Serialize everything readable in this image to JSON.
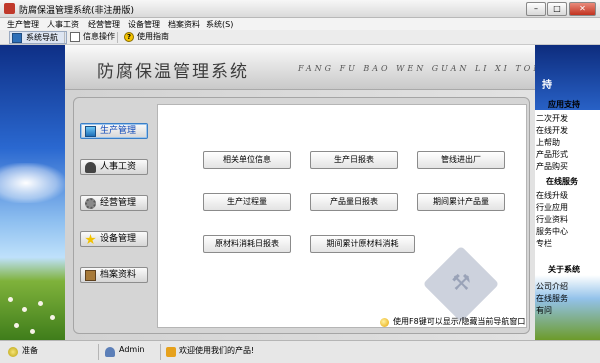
{
  "window": {
    "title": "防腐保温管理系统(非注册版)",
    "min": "–",
    "max": "□",
    "close": "✕"
  },
  "menu": [
    "生产管理",
    "人事工资",
    "经营管理",
    "设备管理",
    "档案资料",
    "系统(S)"
  ],
  "toolbar": [
    {
      "label": "系统导航",
      "icon": "navigation-icon"
    },
    {
      "label": "信息操作",
      "icon": "document-icon"
    },
    {
      "label": "使用指南",
      "icon": "help-icon",
      "glyph": "?"
    }
  ],
  "header": {
    "title": "防腐保温管理系统",
    "subtitle": "FANG FU BAO WEN GUAN LI XI TONG"
  },
  "nav": [
    {
      "label": "生产管理",
      "icon": "monitor-icon",
      "active": true
    },
    {
      "label": "人事工资",
      "icon": "person-icon"
    },
    {
      "label": "经营管理",
      "icon": "gear-icon"
    },
    {
      "label": "设备管理",
      "icon": "star-icon"
    },
    {
      "label": "档案资料",
      "icon": "archive-icon"
    }
  ],
  "functions": [
    "相关单位信息",
    "生产日报表",
    "管线进出厂",
    "生产过程量",
    "产品量日报表",
    "期间累计产品量",
    "原材料消耗日报表",
    "期间累计原材料消耗"
  ],
  "hint": "使用F8键可以显示/隐藏当前导航窗口",
  "right_sidebar": {
    "heading": "持",
    "items": [
      "应用支持",
      "二次开发",
      "在线开发",
      "上帮助",
      "产品形式",
      "产品购买",
      "在线服务",
      "在线升级",
      "行业应用",
      "行业资料",
      "服务中心",
      "专栏",
      "关于系统",
      "公司介绍",
      "在线服务",
      "有问"
    ]
  },
  "status": {
    "state": "准备",
    "user": "Admin",
    "welcome": "欢迎使用我们的产品!"
  },
  "colors": {
    "accent": "#0b46b8",
    "titlebar": "#dadada",
    "close": "#c1321f"
  }
}
